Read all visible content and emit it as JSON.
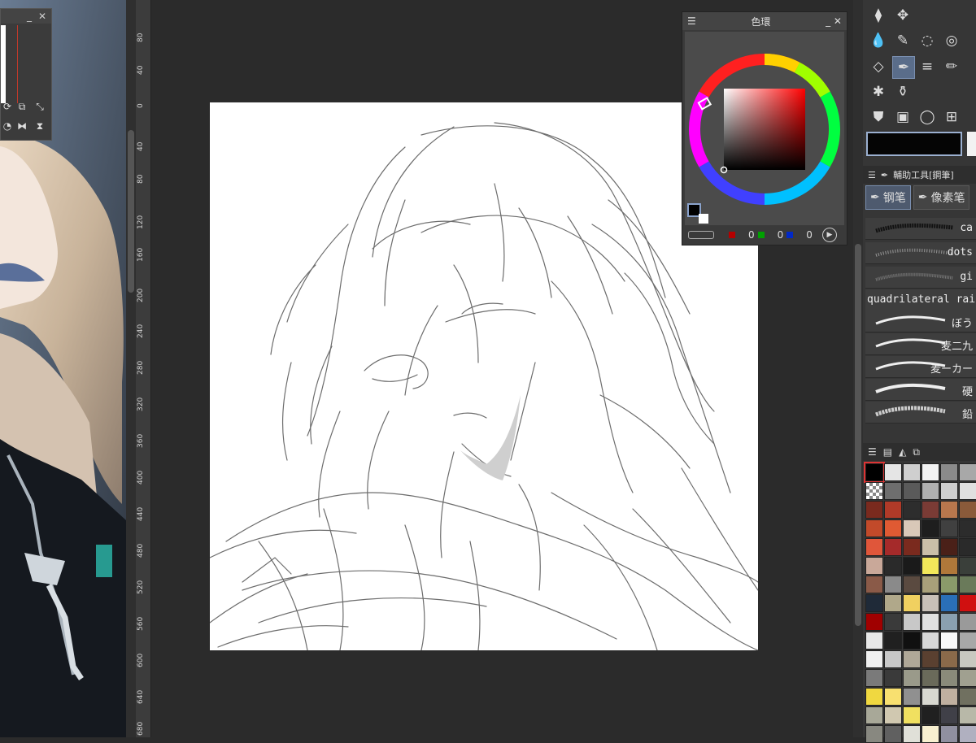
{
  "color_wheel_panel": {
    "title": "色環",
    "rgb": {
      "r": "0",
      "g": "0",
      "b": "0"
    },
    "colors": {
      "red": "#b40000",
      "green": "#00a000",
      "blue": "#0028c8"
    }
  },
  "navigator": {
    "minimize": "_",
    "close": "✕"
  },
  "ruler": {
    "labels": [
      "80",
      "40",
      "0",
      "40",
      "80",
      "120",
      "160",
      "200",
      "240",
      "280",
      "320",
      "360",
      "400",
      "440",
      "480",
      "520",
      "560",
      "600",
      "640",
      "680"
    ]
  },
  "sub_tool_panel": {
    "header": "輔助工具[鋼筆]",
    "tabs": [
      {
        "label": "钢笔"
      },
      {
        "label": "像素笔"
      }
    ],
    "brushes": [
      {
        "name": "ca"
      },
      {
        "name": "dots"
      },
      {
        "name": "gi"
      },
      {
        "name": "quadrilateral rain"
      },
      {
        "name": "ぼう"
      },
      {
        "name": "麦二九"
      },
      {
        "name": "麦ーカー"
      },
      {
        "name": "硬"
      },
      {
        "name": "鉛"
      }
    ]
  },
  "palette": {
    "colors": [
      "#000000",
      "#e5e5e5",
      "#cfcfcf",
      "#f2f2f2",
      "#8a8a8a",
      "#a8a8a8",
      "#bbbbbb",
      "#6e6e6e",
      "#5a5a5a",
      "#b0b0b0",
      "#cfcfcf",
      "#e0e0e0",
      "#7a2a1e",
      "#b03a28",
      "#2d2d2d",
      "#7a3b35",
      "#b8774d",
      "#8a5a3a",
      "#c24a2a",
      "#e05a33",
      "#d9c8b8",
      "#1e1e1e",
      "#404040",
      "#2c2c2c",
      "#e0563a",
      "#a52a2a",
      "#7a2a1e",
      "#c9bfa8",
      "#4a2018",
      "#2a2a2a",
      "#c9a899",
      "#2a2a2a",
      "#1a1a1a",
      "#f2e85a",
      "#b0783a",
      "#3a3f3a",
      "#8a5a48",
      "#8a8a8a",
      "#5a4a40",
      "#a8a07a",
      "#8a9a6a",
      "#6a7a5a",
      "#1f2a38",
      "#b0a88a",
      "#f0d060",
      "#c8c0b8",
      "#2a6fb8",
      "#d01010",
      "#a00000",
      "#3a3a3a",
      "#c8c8c8",
      "#e0e0e0",
      "#8aa0b0",
      "#9a9a9a",
      "#e8e8e8",
      "#202020",
      "#101010",
      "#d8d8d8",
      "#f8f8f8",
      "#a8a8a8",
      "#f0f0f0",
      "#c8c8c8",
      "#b0a898",
      "#5a4030",
      "#8a6a4a",
      "#c8c8c0",
      "#7a7a7a",
      "#3a3a3a",
      "#9a9a8a",
      "#6a6a5a",
      "#8a8a7a",
      "#a0a090",
      "#f0d840",
      "#f8e070",
      "#909090",
      "#d8d8d0",
      "#c0b0a0",
      "#707060",
      "#a8a898",
      "#d0c8b0",
      "#f0e060",
      "#202020",
      "#404048",
      "#b8b8a8",
      "#888880",
      "#606060",
      "#e0e0d8",
      "#f8f0d0",
      "#9090a0",
      "#b0b0c0"
    ]
  }
}
